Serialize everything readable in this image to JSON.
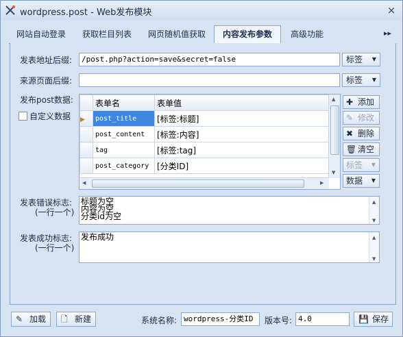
{
  "window": {
    "title": "wordpress.post - Web发布模块",
    "close": "×"
  },
  "tabs": [
    {
      "label": "网站自动登录"
    },
    {
      "label": "获取栏目列表"
    },
    {
      "label": "网页随机值获取"
    },
    {
      "label": "内容发布参数"
    },
    {
      "label": "高级功能"
    }
  ],
  "tab_scroll": "▸▸",
  "post_url": {
    "label": "发表地址后缀:",
    "value": "/post.php?action=save&secret=false",
    "button": "标签"
  },
  "referer": {
    "label": "来源页面后缀:",
    "value": "",
    "button": "标签"
  },
  "post_data": {
    "label": "发布post数据:",
    "custom_label": "自定义数据",
    "columns": [
      "表单名",
      "表单值"
    ],
    "rows": [
      {
        "name": "post_title",
        "value": "[标签:标题]"
      },
      {
        "name": "post_content",
        "value": "[标签:内容]"
      },
      {
        "name": "tag",
        "value": "[标签:tag]"
      },
      {
        "name": "post_category",
        "value": "[分类ID]"
      }
    ]
  },
  "side_buttons": {
    "add": "添加",
    "edit": "修改",
    "delete": "删除",
    "clear": "清空",
    "tag": "标签",
    "data": "数据"
  },
  "error_flag": {
    "label": "发表错误标志:",
    "hint": "(一行一个)",
    "lines": [
      "标题为空",
      "内容为空",
      "分类id为空"
    ]
  },
  "success_flag": {
    "label": "发表成功标志:",
    "hint": "(一行一个)",
    "lines": [
      "发布成功"
    ]
  },
  "footer": {
    "load": "加载",
    "new": "新建",
    "system_name_label": "系统名称:",
    "system_name": "wordpress-分类ID",
    "version_label": "版本号:",
    "version": "4.0",
    "save": "保存"
  },
  "colors": {
    "selection": "#3e87e0",
    "background": "#d6e3f3",
    "border": "#8ea6c7"
  }
}
